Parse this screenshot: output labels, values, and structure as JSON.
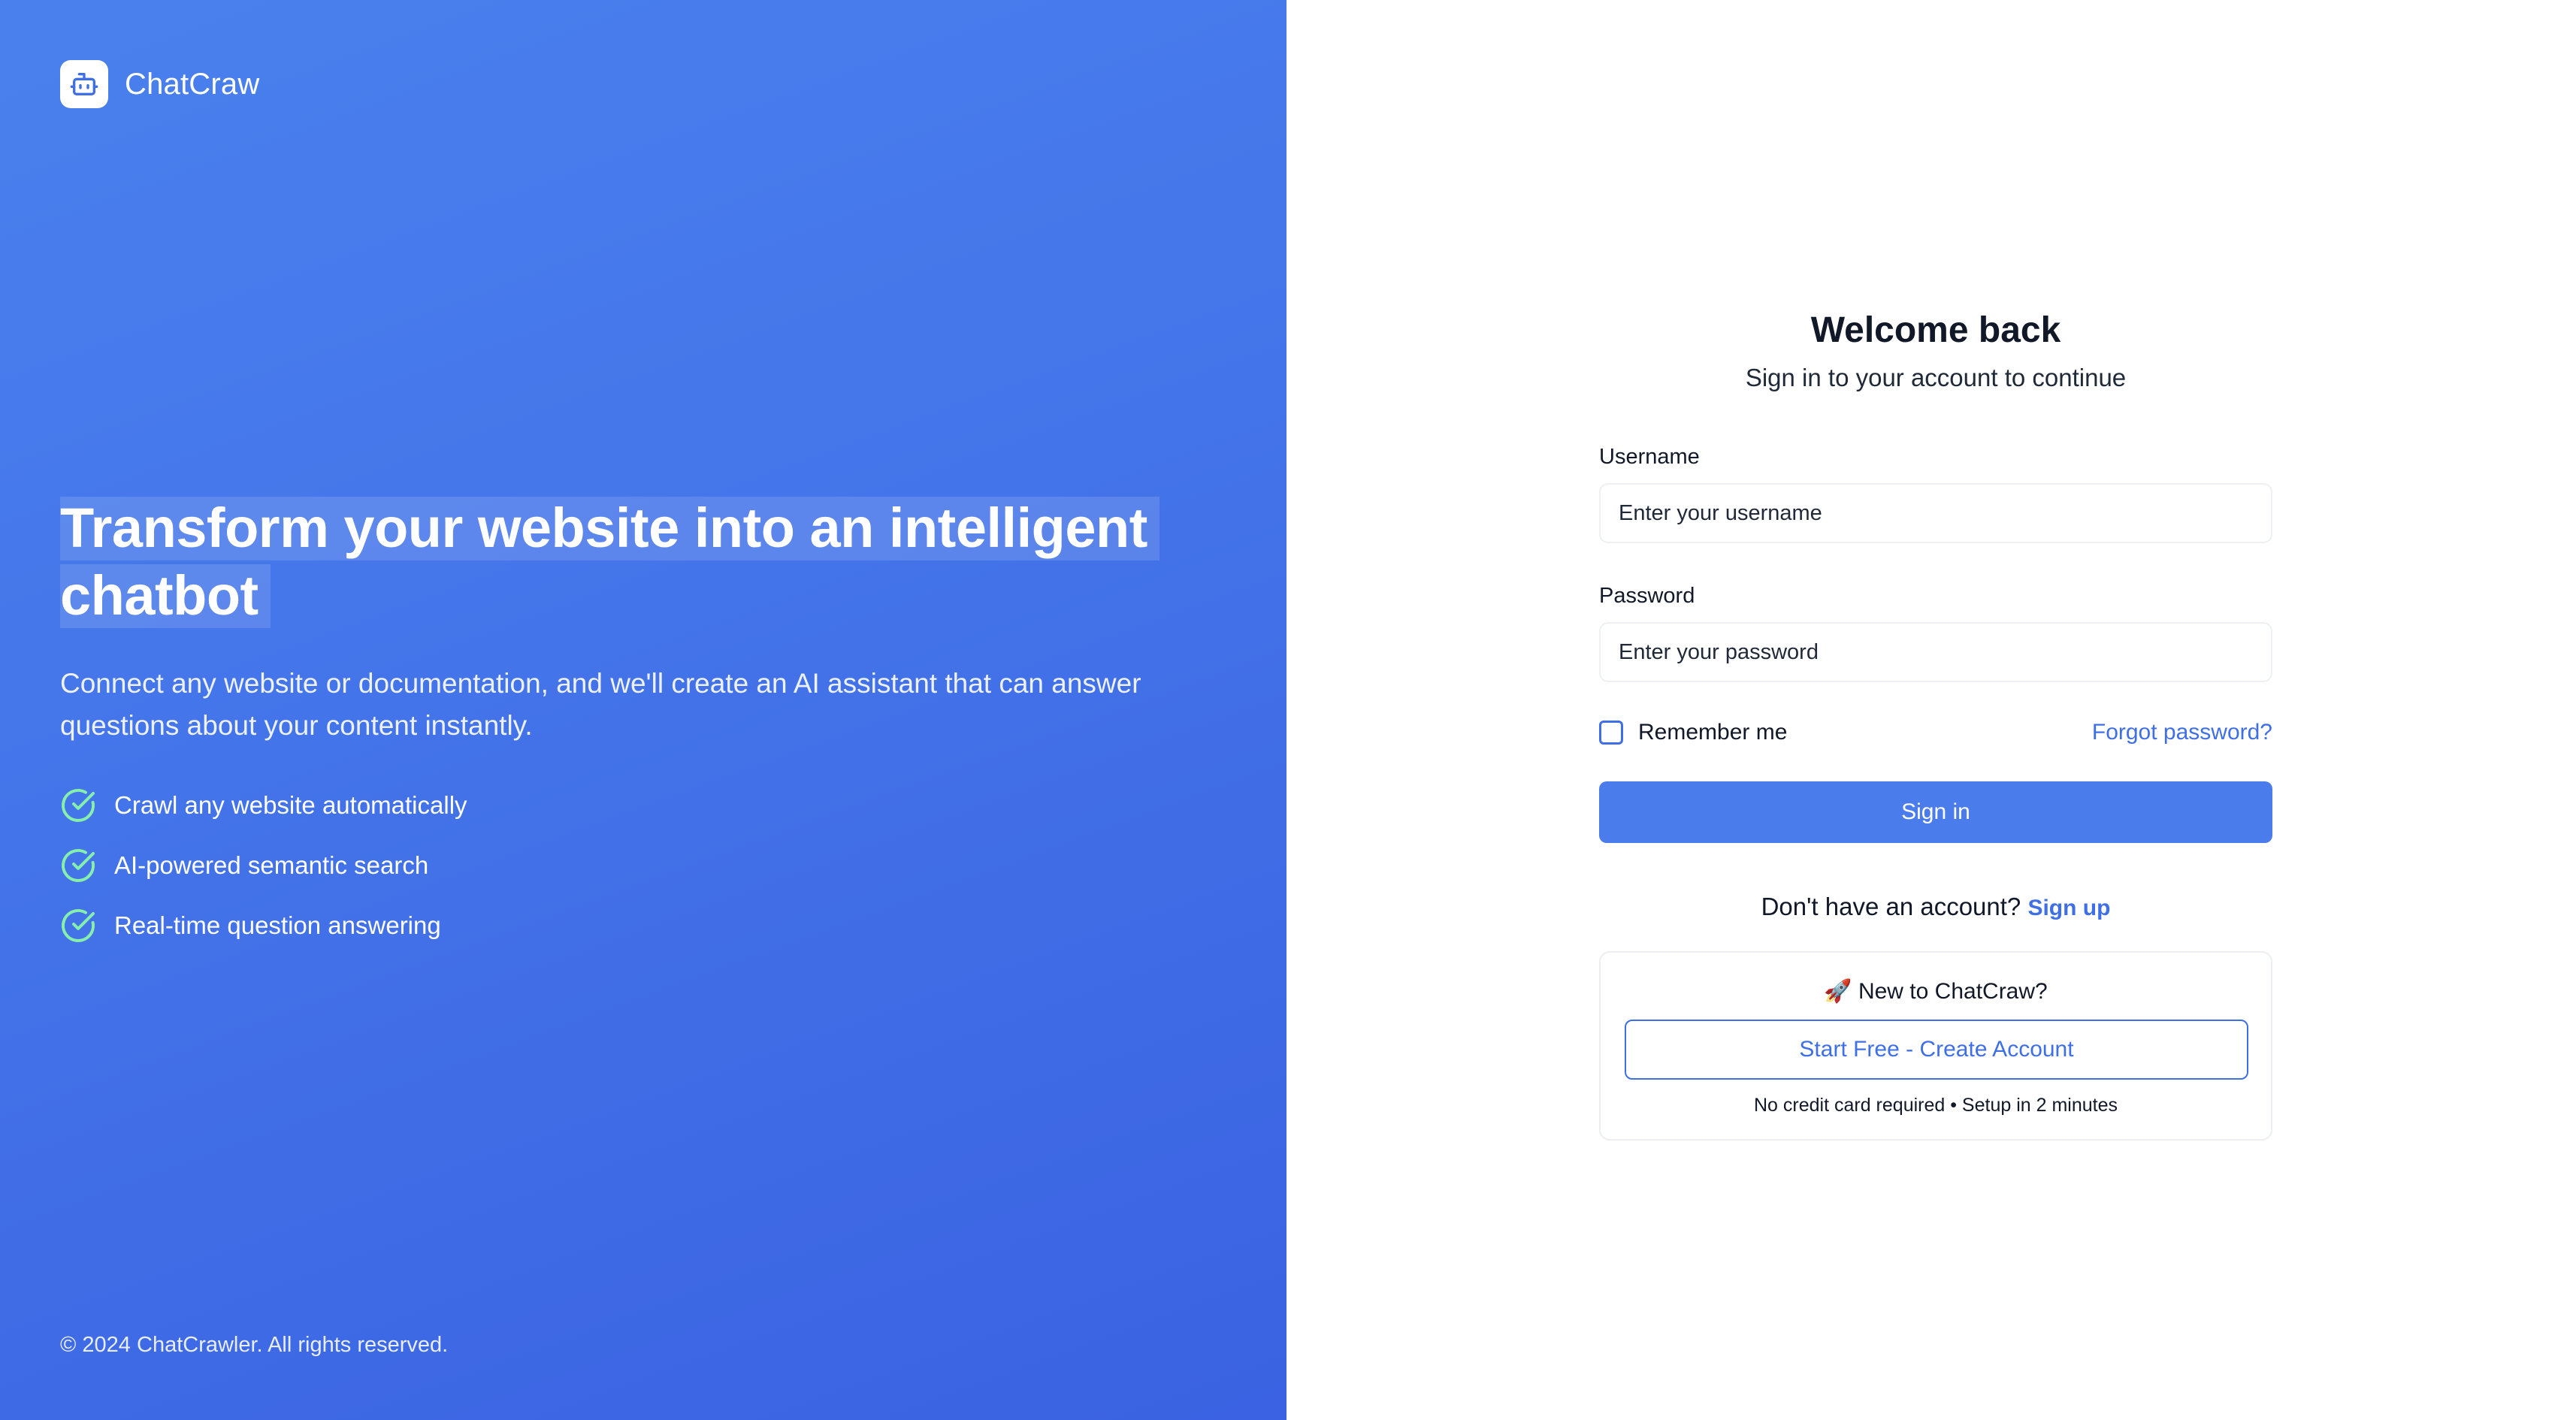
{
  "brand": {
    "name": "ChatCraw",
    "logo_icon": "robot-icon"
  },
  "hero": {
    "title_line1": "Transform your website into an intelligent",
    "title_line2": "chatbot",
    "description": "Connect any website or documentation, and we'll create an AI assistant that can answer questions about your content instantly.",
    "features": [
      {
        "icon": "check-circle-icon",
        "label": "Crawl any website automatically"
      },
      {
        "icon": "check-circle-icon",
        "label": "AI-powered semantic search"
      },
      {
        "icon": "check-circle-icon",
        "label": "Real-time question answering"
      }
    ],
    "copyright": "© 2024 ChatCrawler. All rights reserved."
  },
  "auth": {
    "title": "Welcome back",
    "subtitle": "Sign in to your account to continue",
    "username": {
      "label": "Username",
      "placeholder": "Enter your username",
      "value": ""
    },
    "password": {
      "label": "Password",
      "placeholder": "Enter your password",
      "value": ""
    },
    "remember_label": "Remember me",
    "remember_checked": false,
    "forgot_label": "Forgot password?",
    "signin_label": "Sign in",
    "signup_prompt": "Don't have an account?",
    "signup_label": "Sign up"
  },
  "promo": {
    "title": "🚀 New to ChatCraw?",
    "button_label": "Start Free - Create Account",
    "note": "No credit card required • Setup in 2 minutes"
  },
  "colors": {
    "hero_gradient_start": "#4a80ee",
    "hero_gradient_end": "#3a62e2",
    "accent": "#3f6fe6",
    "button": "#4b7cec",
    "check": "#86efac"
  }
}
